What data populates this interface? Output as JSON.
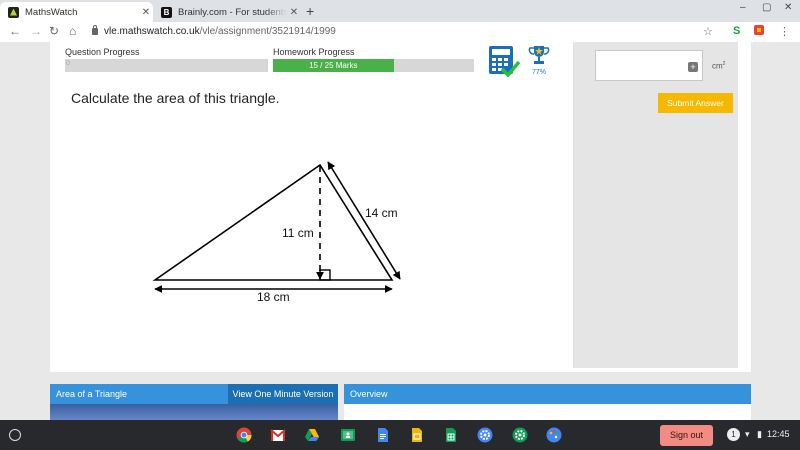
{
  "browser": {
    "tabs": [
      {
        "title": "MathsWatch",
        "active": true
      },
      {
        "title": "Brainly.com - For students. By students",
        "active": false
      }
    ],
    "url_host": "vle.mathswatch.co.uk",
    "url_path": "/vle/assignment/3521914/1999"
  },
  "progress": {
    "question_label": "Question Progress",
    "question_value": "0",
    "homework_label": "Homework Progress",
    "homework_text": "15 / 25 Marks",
    "homework_fraction": 0.6,
    "trophy_percent": "77%"
  },
  "question": {
    "text": "Calculate the area of this triangle."
  },
  "diagram": {
    "height_label": "11 cm",
    "side_label": "14 cm",
    "base_label": "18 cm"
  },
  "answer": {
    "unit": "cm",
    "unit_sup": "2",
    "plus_symbol": "+",
    "submit_label": "Submit Answer"
  },
  "panels": {
    "video_title": "Area of a Triangle",
    "video_button": "View One Minute Version",
    "overview_title": "Overview"
  },
  "shelf": {
    "signout_label": "Sign out",
    "notification_count": "1",
    "time": "12:45"
  },
  "colors": {
    "progress_green": "#4ab14a",
    "submit_yellow": "#f6b800",
    "panel_blue": "#3592db"
  }
}
